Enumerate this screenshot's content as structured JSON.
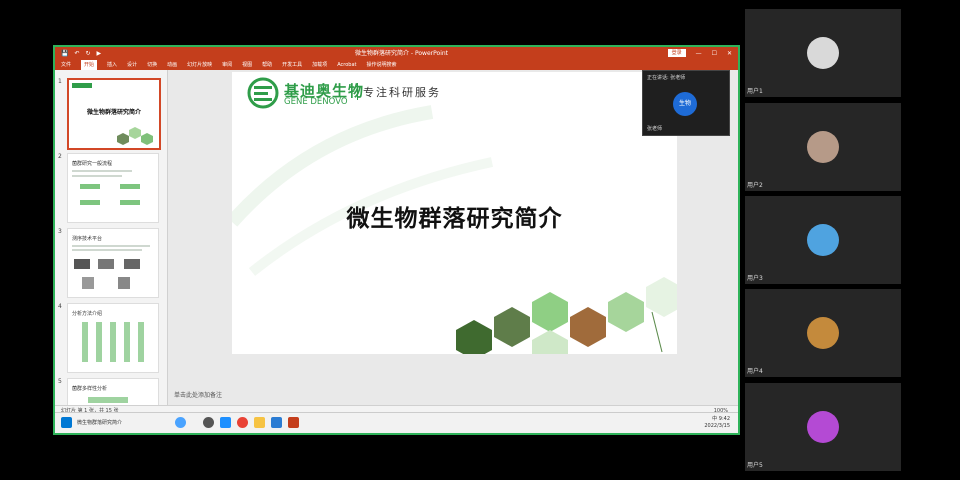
{
  "window": {
    "title": "微生物群落研究简介 - PowerPoint",
    "sign_in": "登录",
    "controls": [
      "—",
      "☐",
      "✕"
    ],
    "quick_access": [
      "💾",
      "↶",
      "↻",
      "▶"
    ]
  },
  "ribbon": {
    "tabs": [
      "文件",
      "开始",
      "插入",
      "设计",
      "切换",
      "动画",
      "幻灯片放映",
      "审阅",
      "视图",
      "帮助",
      "开发工具",
      "加载项",
      "Acrobat",
      "操作说明搜索"
    ],
    "active_index": 1
  },
  "thumbnails": [
    {
      "num": "1",
      "title": "微生物群落研究简介"
    },
    {
      "num": "2",
      "title": "菌群研究一般流程"
    },
    {
      "num": "3",
      "title": "测序技术平台"
    },
    {
      "num": "4",
      "title": "分析方法介绍"
    },
    {
      "num": "5",
      "title": "菌群多样性分析"
    }
  ],
  "slide": {
    "brand_cn": "基迪奥生物",
    "brand_en": "GENE DENOVO",
    "tagline": "专注科研服务",
    "title": "微生物群落研究简介",
    "notes_placeholder": "单击此处添加备注"
  },
  "presenter_tile": {
    "top_label": "正在讲话: 张老师",
    "avatar_text": "生物",
    "bottom_label": "张老师"
  },
  "statusbar": {
    "left": "幻灯片 第 1 张，共 15 张",
    "zoom": "100%"
  },
  "taskbar": {
    "app_label": "微生物群落研究简介",
    "clock": "9:42",
    "date": "2022/3/15",
    "ime": "中"
  },
  "participants": [
    {
      "name": "用户1",
      "avatar_color": "#d9d9d9"
    },
    {
      "name": "用户2",
      "avatar_color": "#b69a88"
    },
    {
      "name": "用户3",
      "avatar_color": "#4fa3e0"
    },
    {
      "name": "用户4",
      "avatar_color": "#c48a3c"
    },
    {
      "name": "用户5",
      "avatar_color": "#b44ad4"
    }
  ],
  "colors": {
    "ppt_accent": "#c43e1c",
    "brand_green": "#2f9d49",
    "share_border": "#2fb35a"
  }
}
